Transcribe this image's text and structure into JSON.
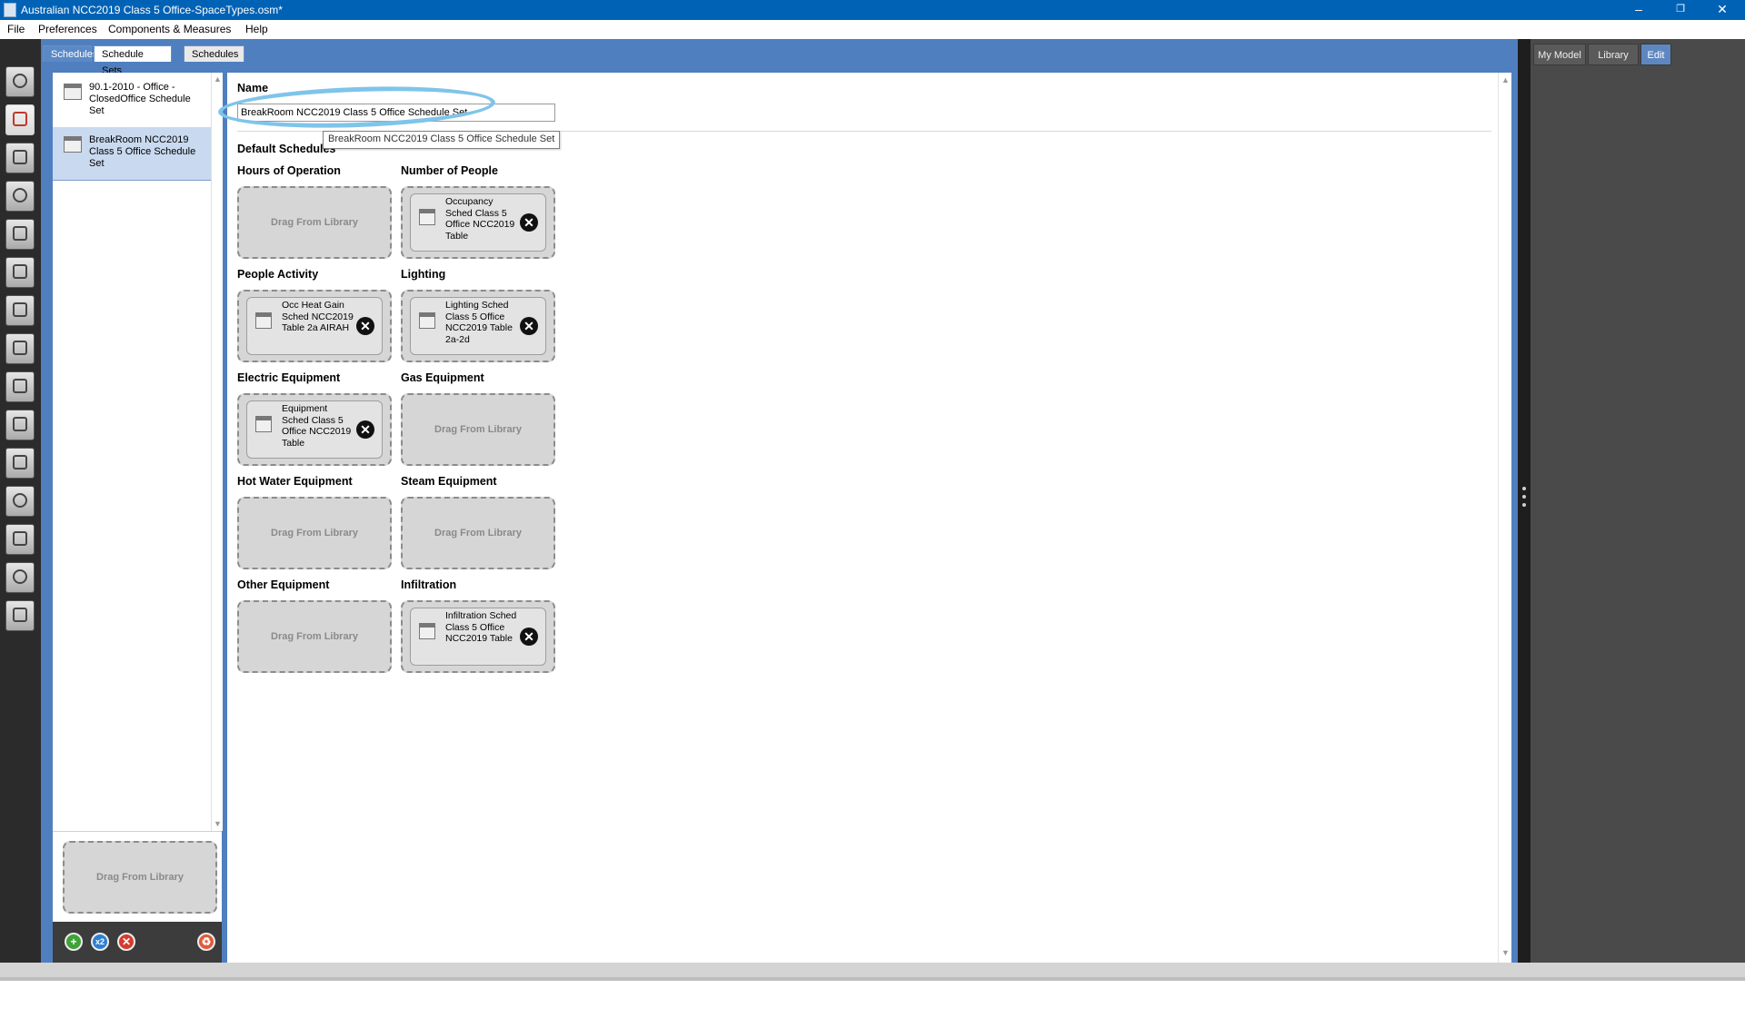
{
  "window": {
    "title": "Australian NCC2019 Class 5 Office-SpaceTypes.osm*",
    "minimize": "–",
    "restore": "❐",
    "close": "✕"
  },
  "menu": {
    "items": [
      "File",
      "Preferences",
      "Components & Measures",
      "Help"
    ]
  },
  "tabs": {
    "header": "Schedules",
    "schedule_sets": "Schedule Sets",
    "schedules": "Schedules"
  },
  "right_tabs": {
    "my_model": "My Model",
    "library": "Library",
    "edit": "Edit"
  },
  "list": {
    "items": [
      {
        "label": "90.1-2010 - Office - ClosedOffice Schedule Set"
      },
      {
        "label": "BreakRoom NCC2019 Class 5 Office Schedule Set"
      }
    ],
    "drop_label": "Drag From Library"
  },
  "editor": {
    "name_label": "Name",
    "name_value": "BreakRoom NCC2019 Class 5 Office Schedule Set",
    "tooltip": "BreakRoom NCC2019 Class 5 Office Schedule Set",
    "section_title": "Default Schedules",
    "slots": {
      "hours_of_operation": {
        "label": "Hours of Operation",
        "value": "Drag From Library"
      },
      "number_of_people": {
        "label": "Number of People",
        "value": "Occupancy Sched Class 5 Office NCC2019 Table"
      },
      "people_activity": {
        "label": "People Activity",
        "value": "Occ Heat Gain Sched NCC2019 Table 2a AIRAH"
      },
      "lighting": {
        "label": "Lighting",
        "value": "Lighting Sched Class 5 Office NCC2019 Table 2a-2d"
      },
      "electric_equipment": {
        "label": "Electric Equipment",
        "value": "Equipment Sched Class 5 Office NCC2019 Table"
      },
      "gas_equipment": {
        "label": "Gas Equipment",
        "value": "Drag From Library"
      },
      "hot_water_equipment": {
        "label": "Hot Water Equipment",
        "value": "Drag From Library"
      },
      "steam_equipment": {
        "label": "Steam Equipment",
        "value": "Drag From Library"
      },
      "other_equipment": {
        "label": "Other Equipment",
        "value": "Drag From Library"
      },
      "infiltration": {
        "label": "Infiltration",
        "value": "Infiltration Sched Class 5 Office NCC2019 Table"
      }
    }
  },
  "footer": {
    "add": "+",
    "copy": "x2",
    "remove": "✕",
    "purge": "♻"
  },
  "colors": {
    "titlebar": "#0062b5",
    "frame": "#4f7fbf",
    "highlight": "#7fc4ea"
  }
}
